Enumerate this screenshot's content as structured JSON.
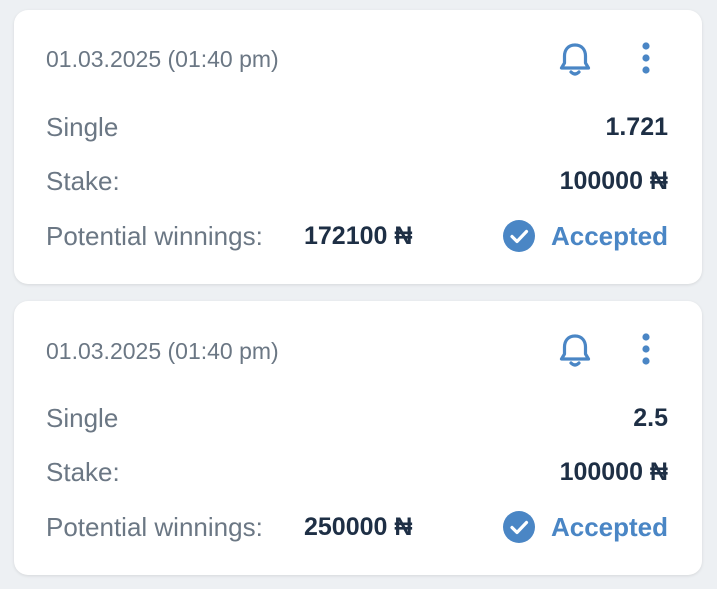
{
  "bets": [
    {
      "date": "01.03.2025 (01:40 pm)",
      "type_label": "Single",
      "odds": "1.721",
      "stake_label": "Stake:",
      "stake": "100000 ₦",
      "winnings_label": "Potential winnings:",
      "winnings": "172100 ₦",
      "status": "Accepted"
    },
    {
      "date": "01.03.2025 (01:40 pm)",
      "type_label": "Single",
      "odds": "2.5",
      "stake_label": "Stake:",
      "stake": "100000 ₦",
      "winnings_label": "Potential winnings:",
      "winnings": "250000 ₦",
      "status": "Accepted"
    }
  ],
  "icons": {
    "notify": "bell-icon",
    "menu": "more-vertical-icon",
    "status": "check-circle-icon"
  },
  "colors": {
    "accent": "#4a86c5",
    "label": "#6b7784",
    "value": "#1e2f45",
    "background": "#edf0f3"
  }
}
